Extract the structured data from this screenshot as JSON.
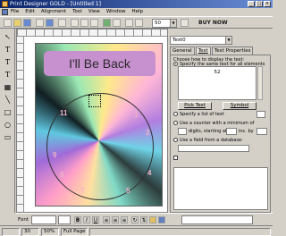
{
  "window": {
    "title": "Print Designer GOLD - [Untitled 1]"
  },
  "menu": {
    "items": [
      "File",
      "Edit",
      "Alignment",
      "Tool",
      "View",
      "Window",
      "Help"
    ]
  },
  "toolbar": {
    "zoom": "50",
    "buy_now": "BUY NOW"
  },
  "canvas": {
    "banner_text": "I'll Be Back",
    "clock_numbers": {
      "n1": "1",
      "n2": "2",
      "n4": "4",
      "n5": "5",
      "n7": "7",
      "n8": "8",
      "n9": "9",
      "n11": "11"
    }
  },
  "right_panel": {
    "field_name": "Text0",
    "tabs": [
      "General",
      "Text",
      "Text Properties"
    ],
    "prompt": "Choose how to display the text:",
    "option_same": "Specify the same text for all elements",
    "text_value": "52",
    "pick_text": "Pick Text",
    "symbol": "Symbol",
    "option_list": "Specify a list of text",
    "option_counter": "Use a counter with a minimum of",
    "digits_label": "digits, starting at",
    "inc_label": "inc. by",
    "option_database": "Use a field from a database:"
  },
  "bottom_toolbar": {
    "font_label": "Font"
  },
  "status": {
    "cell1": "",
    "cell2": "30",
    "cell3": "50%",
    "cell4": "Full Page"
  }
}
